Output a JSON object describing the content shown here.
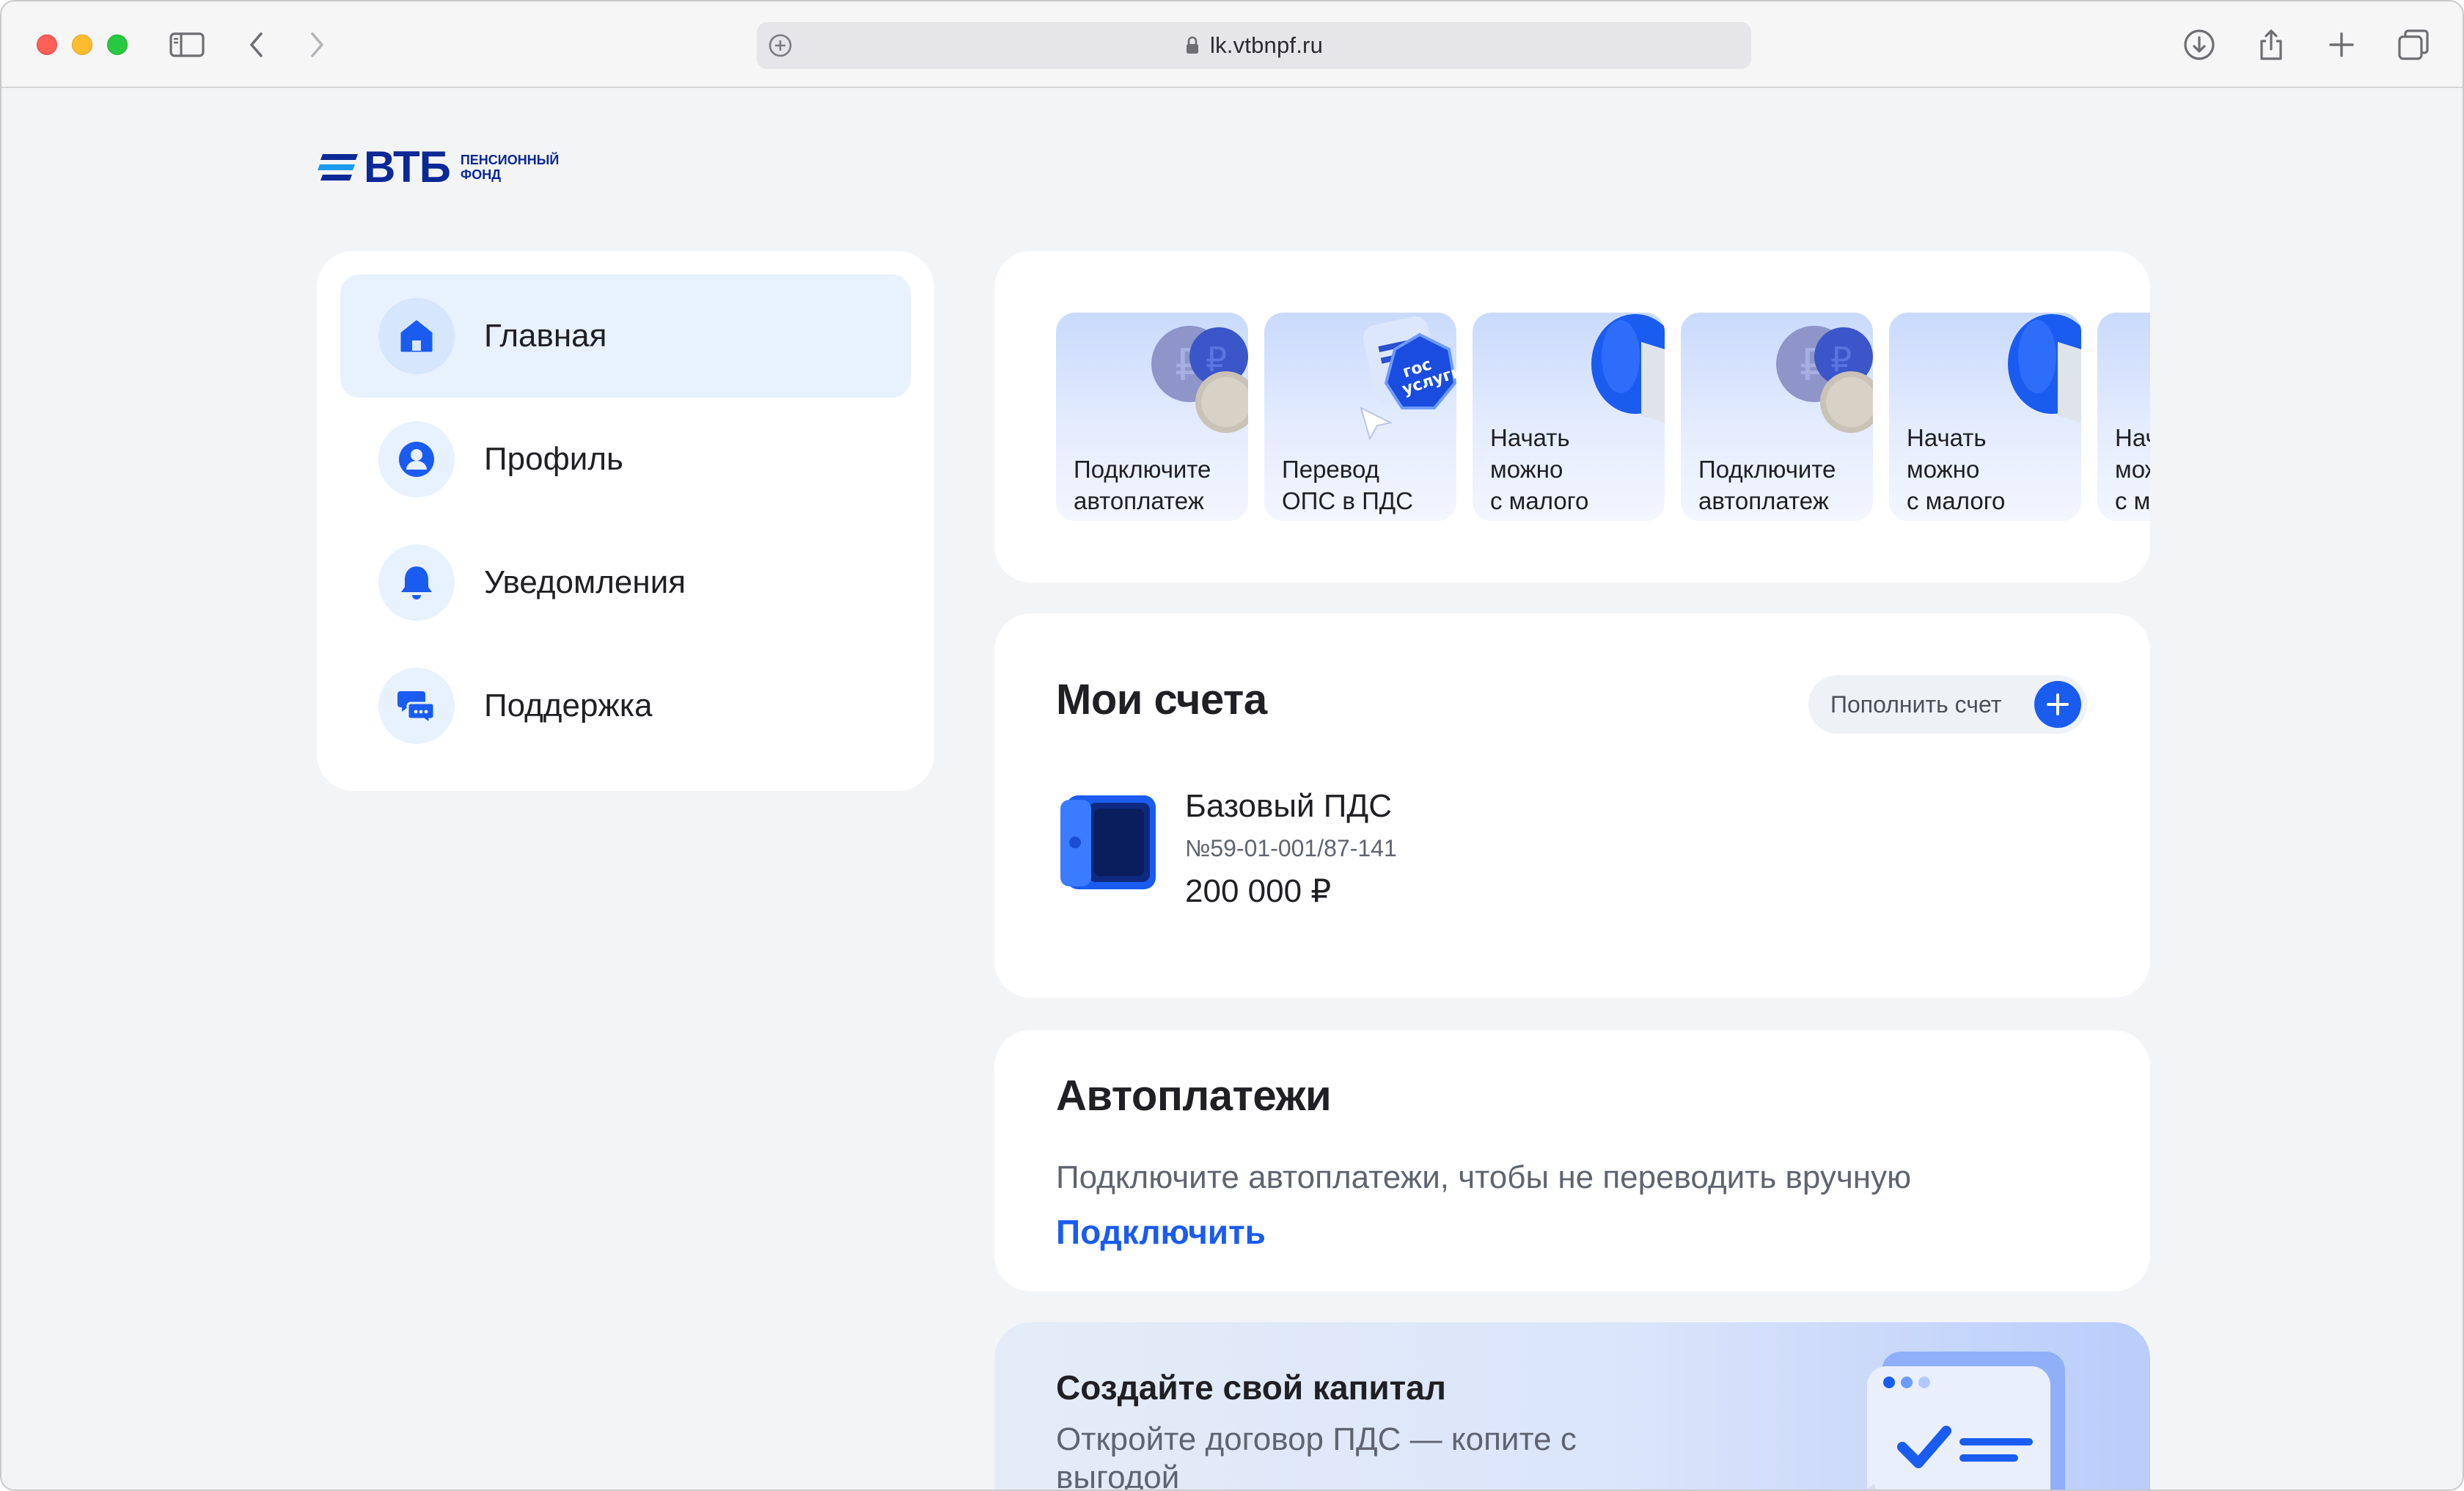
{
  "browser": {
    "url": "lk.vtbnpf.ru"
  },
  "logo": {
    "name": "ВТБ",
    "subtitle_line1": "ПЕНСИОННЫЙ",
    "subtitle_line2": "ФОНД"
  },
  "sidebar": {
    "items": [
      {
        "label": "Главная",
        "icon": "home-icon",
        "active": true
      },
      {
        "label": "Профиль",
        "icon": "user-icon",
        "active": false
      },
      {
        "label": "Уведомления",
        "icon": "bell-icon",
        "active": false
      },
      {
        "label": "Поддержка",
        "icon": "chat-icon",
        "active": false
      }
    ]
  },
  "promos": [
    {
      "text": "Подключите\nавтоплатеж",
      "art": "coins-icon"
    },
    {
      "text": "Перевод\nОПС в ПДС",
      "art": "gosuslugi-icon"
    },
    {
      "text": "Начать\nможно\nс малого",
      "art": "piggy-icon"
    },
    {
      "text": "Подключите\nавтоплатеж",
      "art": "coins-icon"
    },
    {
      "text": "Начать\nможно\nс малого",
      "art": "piggy-icon"
    },
    {
      "text": "Начать\nможно\nс малого",
      "art": "piggy-icon"
    }
  ],
  "accounts": {
    "title": "Мои счета",
    "topup_label": "Пополнить счет",
    "items": [
      {
        "name": "Базовый ПДС",
        "number": "№59-01-001/87-141",
        "balance": "200 000 ₽",
        "icon": "safe-icon"
      }
    ]
  },
  "autopay": {
    "title": "Автоплатежи",
    "description": "Подключите автоплатежи, чтобы не переводить вручную",
    "link": "Подключить"
  },
  "capital": {
    "title": "Создайте свой капитал",
    "description": "Откройте договор ПДС — копите с выгодой"
  },
  "colors": {
    "accent": "#1a5cf0",
    "brand": "#0a2896",
    "page_bg": "#f3f4f6",
    "active_nav_bg": "#e8f1fe"
  }
}
